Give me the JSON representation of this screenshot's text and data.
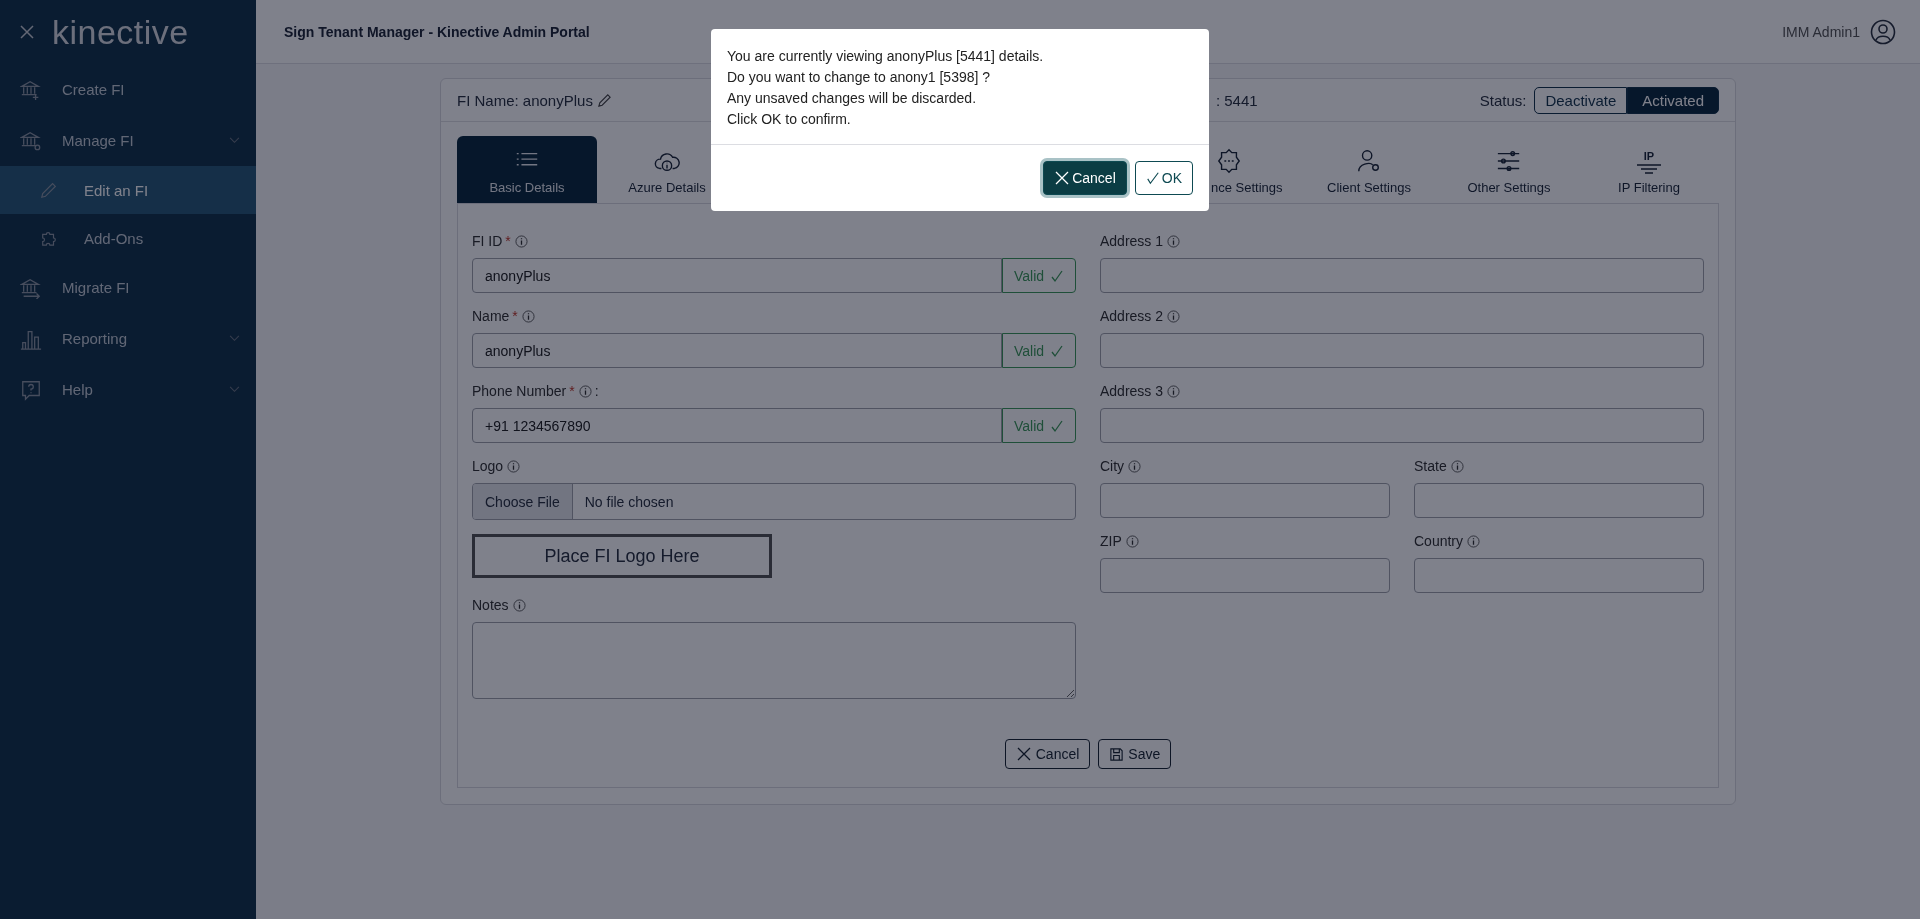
{
  "sidebar": {
    "logo": "kinective",
    "items": [
      {
        "label": "Create FI",
        "selected": false,
        "expandable": false
      },
      {
        "label": "Manage FI",
        "selected": false,
        "expandable": true,
        "children": [
          {
            "label": "Edit an FI",
            "selected": true
          },
          {
            "label": "Add-Ons",
            "selected": false
          }
        ]
      },
      {
        "label": "Migrate FI",
        "selected": false,
        "expandable": false
      },
      {
        "label": "Reporting",
        "selected": false,
        "expandable": true
      },
      {
        "label": "Help",
        "selected": false,
        "expandable": true
      }
    ]
  },
  "header": {
    "title": "Sign Tenant Manager - Kinective Admin Portal",
    "user": "IMM Admin1"
  },
  "card": {
    "fi_name": "FI Name: anonyPlus",
    "id_fragment": ": 5441",
    "status_label": "Status:",
    "status_options": [
      {
        "label": "Deactivate",
        "selected": false
      },
      {
        "label": "Activated",
        "selected": true
      }
    ]
  },
  "tabs": [
    {
      "label": "Basic Details",
      "selected": true,
      "kind": "full"
    },
    {
      "label": "Azure Details",
      "selected": false,
      "kind": "full"
    },
    {
      "label": "nce Settings",
      "selected": false,
      "kind": "cut"
    },
    {
      "label": "Client Settings",
      "selected": false,
      "kind": "full"
    },
    {
      "label": "Other Settings",
      "selected": false,
      "kind": "full"
    },
    {
      "label": "IP Filtering",
      "selected": false,
      "kind": "full",
      "icon_text": "IP"
    }
  ],
  "left_fields": [
    {
      "kind": "text",
      "label": "FI ID",
      "required_mark": "*",
      "value": "anonyPlus",
      "status": "Valid"
    },
    {
      "kind": "text",
      "label": "Name",
      "required_mark": "*",
      "value": "anonyPlus",
      "status": "Valid"
    },
    {
      "kind": "text",
      "label": "Phone Number",
      "required_mark": "*",
      "suffix": ":",
      "value": "+91 1234567890",
      "status": "Valid"
    },
    {
      "kind": "file",
      "label": "Logo",
      "button": "Choose File",
      "value": "No file chosen"
    },
    {
      "kind": "logo",
      "value": "Place FI Logo Here"
    },
    {
      "kind": "textarea",
      "label": "Notes"
    }
  ],
  "right_fields": [
    {
      "label": "Address 1",
      "half": false
    },
    {
      "label": "Address 2",
      "half": false
    },
    {
      "label": "Address 3",
      "half": false
    },
    {
      "label": "City",
      "half": true
    },
    {
      "label": "State",
      "half": true
    },
    {
      "label": "ZIP",
      "half": true
    },
    {
      "label": "Country",
      "half": true
    }
  ],
  "form_buttons": [
    {
      "label": "Cancel",
      "kind": "cancel"
    },
    {
      "label": "Save",
      "kind": "save"
    }
  ],
  "dialog": {
    "lines": [
      "You are currently viewing anonyPlus [5441] details.",
      "Do you want to change to anony1 [5398] ?",
      "Any unsaved changes will be discarded.",
      "Click OK to confirm."
    ],
    "buttons": [
      {
        "label": "Cancel",
        "kind": "cancel",
        "primary": true
      },
      {
        "label": "OK",
        "kind": "ok",
        "primary": false
      }
    ]
  }
}
